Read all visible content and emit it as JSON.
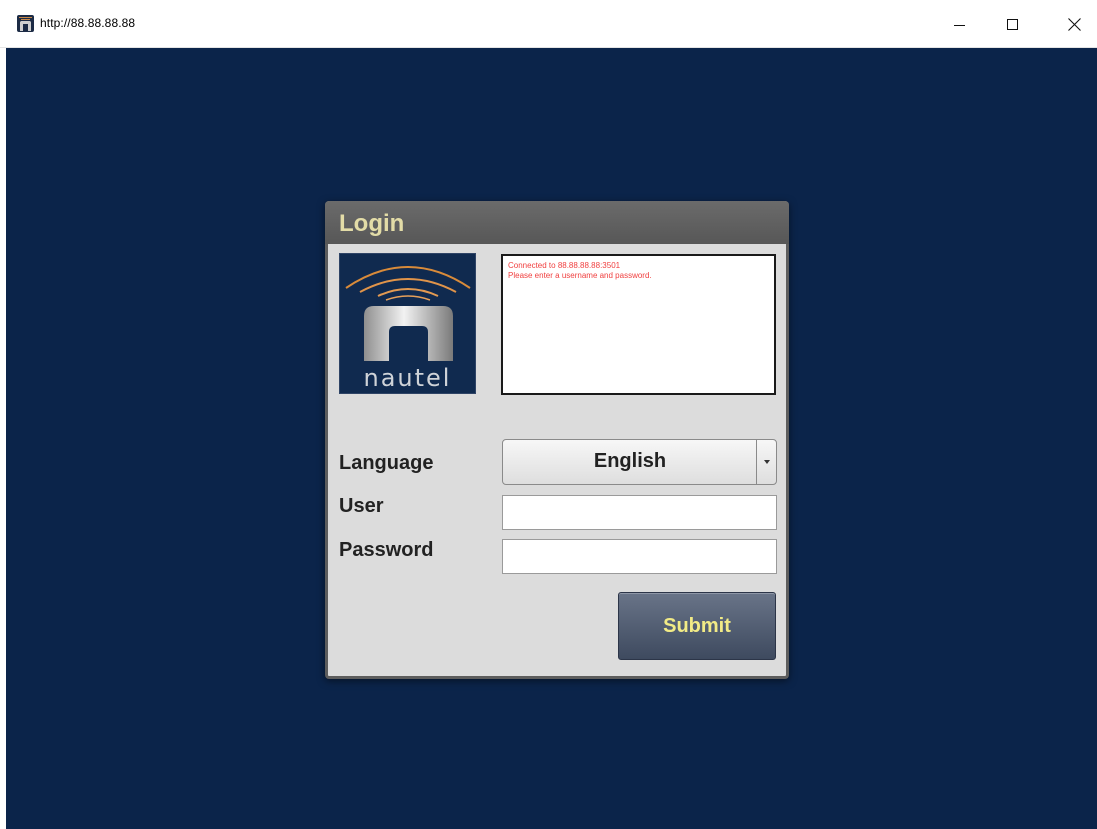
{
  "window": {
    "title": "http://88.88.88.88",
    "icon": "nautel-app-icon"
  },
  "dialog": {
    "title": "Login",
    "logo_text": "nautel",
    "messages": [
      "Connected to 88.88.88.88:3501",
      "Please enter a username and password."
    ],
    "language_label": "Language",
    "language_value": "English",
    "user_label": "User",
    "user_value": "",
    "password_label": "Password",
    "password_value": "",
    "submit_label": "Submit"
  },
  "colors": {
    "page_background": "#0b244a",
    "dialog_title": "#e3dca7",
    "message_text": "#f04040",
    "submit_text": "#f2eb86"
  }
}
